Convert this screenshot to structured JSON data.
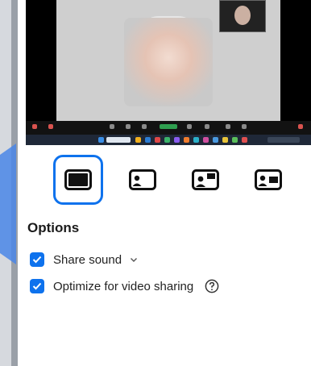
{
  "options": {
    "heading": "Options",
    "share_sound_label": "Share sound",
    "share_sound_checked": true,
    "optimize_video_label": "Optimize for video sharing",
    "optimize_video_checked": true
  },
  "layouts": {
    "selected_index": 0,
    "items": [
      {
        "icon": "fullscreen-layout-icon"
      },
      {
        "icon": "picture-in-picture-layout-icon"
      },
      {
        "icon": "side-by-side-layout-icon"
      },
      {
        "icon": "presenter-layout-icon"
      }
    ]
  },
  "colors": {
    "accent": "#0e72ed",
    "panel_background": "#ffffff",
    "preview_background": "#000000"
  }
}
